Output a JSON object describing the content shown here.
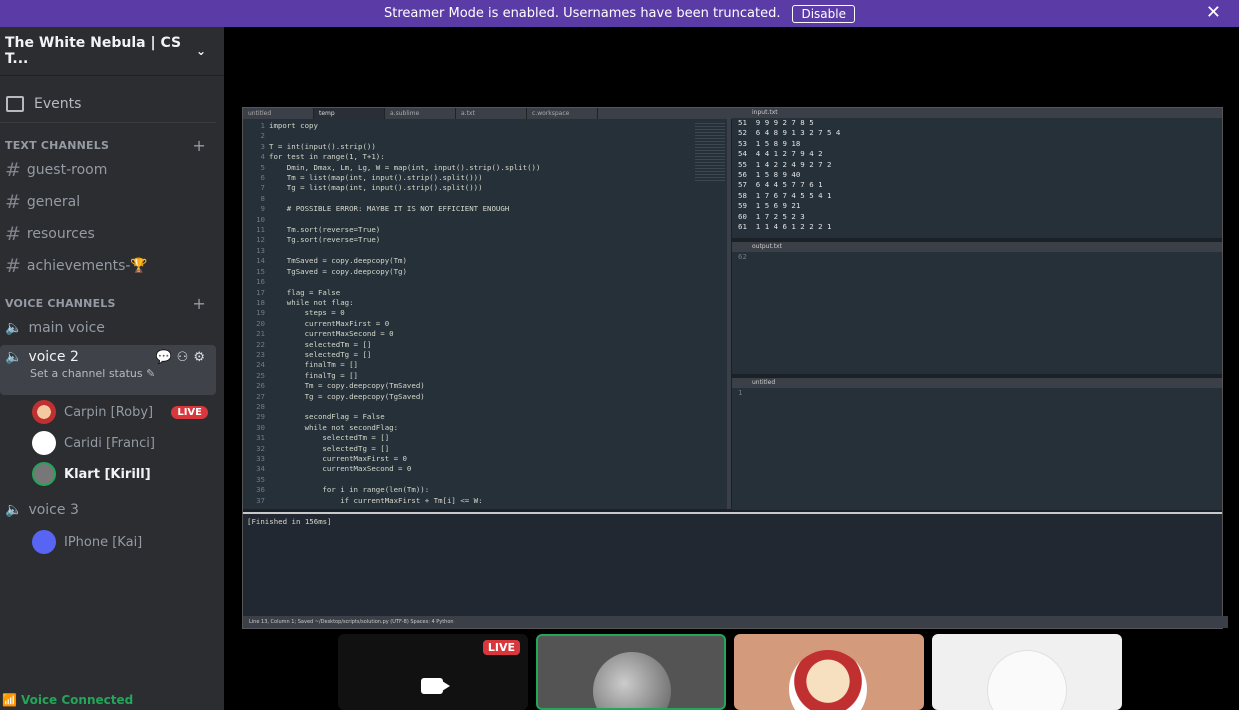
{
  "banner": {
    "text": "Streamer Mode is enabled. Usernames have been truncated.",
    "disable": "Disable",
    "close": "✕"
  },
  "server": {
    "name": "The White Nebula | CS T...",
    "chevron": "⌄"
  },
  "events": {
    "label": "Events"
  },
  "text_channels": {
    "header": "TEXT CHANNELS",
    "items": [
      {
        "label": "guest-room"
      },
      {
        "label": "general"
      },
      {
        "label": "resources"
      },
      {
        "label": "achievements-🏆"
      }
    ]
  },
  "voice_channels": {
    "header": "VOICE CHANNELS",
    "main": {
      "label": "main voice"
    },
    "voice2": {
      "label": "voice 2",
      "status": "Set a channel status ✎",
      "users": [
        {
          "name": "Carpin [Roby]",
          "live": "LIVE"
        },
        {
          "name": "Caridi [Franci]"
        },
        {
          "name": "Klart [Kirill]"
        }
      ]
    },
    "voice3": {
      "label": "voice 3",
      "users": [
        {
          "name": "IPhone [Kai]"
        }
      ]
    }
  },
  "voice_status": {
    "label": "Voice Connected"
  },
  "editor": {
    "tabs": [
      "untitled",
      "temp",
      "a.sublime",
      "a.txt",
      "c.workspace"
    ],
    "right_tab_top": "input.txt",
    "right_tab_mid": "output.txt",
    "right_tab_bot": "untitled",
    "code": "import copy\n\nT = int(input().strip())\nfor test in range(1, T+1):\n    Dmin, Dmax, Lm, Lg, W = map(int, input().strip().split())\n    Tm = list(map(int, input().strip().split()))\n    Tg = list(map(int, input().strip().split()))\n\n    # POSSIBLE ERROR: MAYBE IT IS NOT EFFICIENT ENOUGH\n\n    Tm.sort(reverse=True)\n    Tg.sort(reverse=True)\n\n    TmSaved = copy.deepcopy(Tm)\n    TgSaved = copy.deepcopy(Tg)\n\n    flag = False\n    while not flag:\n        steps = 0\n        currentMaxFirst = 0\n        currentMaxSecond = 0\n        selectedTm = []\n        selectedTg = []\n        finalTm = []\n        finalTg = []\n        Tm = copy.deepcopy(TmSaved)\n        Tg = copy.deepcopy(TgSaved)\n\n        secondFlag = False\n        while not secondFlag:\n            selectedTm = []\n            selectedTg = []\n            currentMaxFirst = 0\n            currentMaxSecond = 0\n\n            for i in range(len(Tm)):\n                if currentMaxFirst + Tm[i] <= W:",
    "input_lines": "51  9 9 9 2 7 8 5\n52  6 4 8 9 1 3 2 7 5 4\n53  1 5 8 9 18\n54  4 4 1 2 7 9 4 2\n55  1 4 2 2 4 9 2 7 2\n56  1 5 8 9 40\n57  6 4 4 5 7 7 6 1\n58  1 7 6 7 4 5 5 4 1\n59  1 5 6 9 21\n60  1 7 2 5 2 3\n61  1 1 4 6 1 2 2 2 1",
    "output_line": "62",
    "untitled_line": "1",
    "result": "[Finished in 156ms]",
    "statusbar": "Line 13, Column 1; Saved ~/Desktop/scripts/solution.py (UTF-8)          Spaces: 4          Python"
  },
  "tiles": {
    "live": "LIVE"
  },
  "icons": {
    "events": "calendar-icon",
    "hash": "hash-icon",
    "speaker": "speaker-icon"
  }
}
